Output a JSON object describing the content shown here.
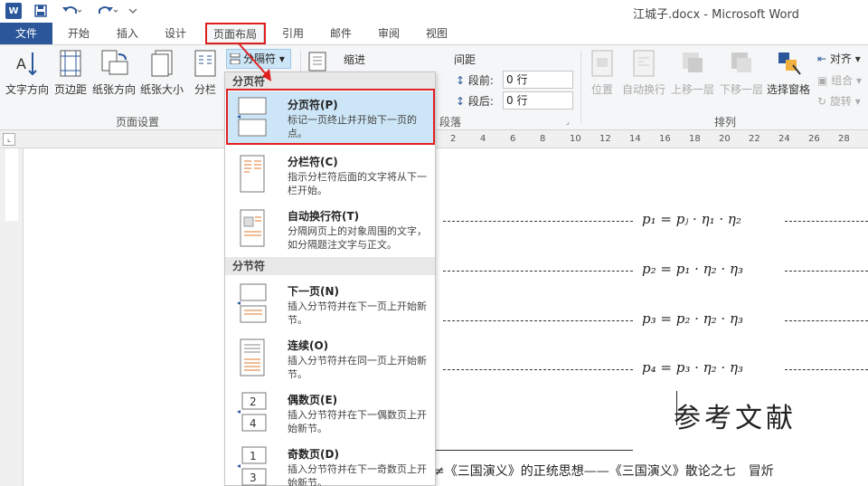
{
  "title": "江城子.docx - Microsoft Word",
  "quick_access": {
    "word": "W",
    "save": "save-icon",
    "undo": "undo-icon",
    "redo": "redo-icon"
  },
  "tabs": [
    "文件",
    "开始",
    "插入",
    "设计",
    "页面布局",
    "引用",
    "邮件",
    "审阅",
    "视图"
  ],
  "ribbon": {
    "page_setup": {
      "buttons": [
        "文字方向",
        "页边距",
        "纸张方向",
        "纸张大小",
        "分栏"
      ],
      "label": "页面设置"
    },
    "breaks_label": "分隔符",
    "indent_label": "缩进",
    "spacing_label": "间距",
    "before_label": "段前:",
    "before_value": "0 行",
    "after_label": "段后:",
    "after_value": "0 行",
    "paragraph_label": "段落",
    "arrange": {
      "buttons": [
        "位置",
        "自动换行",
        "上移一层",
        "下移一层",
        "选择窗格"
      ],
      "side": [
        "对齐",
        "组合",
        "旋转"
      ],
      "label": "排列"
    }
  },
  "ruler_numbers": [
    "2",
    "4",
    "6",
    "8",
    "10",
    "12",
    "14",
    "16",
    "18",
    "20",
    "22",
    "24",
    "26",
    "28"
  ],
  "menu": {
    "section1": "分页符",
    "section2": "分节符",
    "items": [
      {
        "title": "分页符(P)",
        "desc": "标记一页终止并开始下一页的点。"
      },
      {
        "title": "分栏符(C)",
        "desc": "指示分栏符后面的文字将从下一栏开始。"
      },
      {
        "title": "自动换行符(T)",
        "desc": "分隔网页上的对象周围的文字，如分隔题注文字与正文。"
      },
      {
        "title": "下一页(N)",
        "desc": "插入分节符并在下一页上开始新节。"
      },
      {
        "title": "连续(O)",
        "desc": "插入分节符并在同一页上开始新节。"
      },
      {
        "title": "偶数页(E)",
        "desc": "插入分节符并在下一偶数页上开始新节。"
      },
      {
        "title": "奇数页(D)",
        "desc": "插入分节符并在下一奇数页上开始新节。"
      }
    ]
  },
  "document": {
    "formulas": [
      "p₁ = pⱼ · η₁ · η₂",
      "p₂ = p₁ · η₂ · η₃",
      "p₃ = p₂ · η₂ · η₃",
      "p₄ = p₃ · η₂ · η₃"
    ],
    "heading": "参考文献",
    "ref_line": "≠《三国演义》的正统思想——《三国演义》散论之七　冒炘"
  },
  "colors": {
    "accent": "#2b579a",
    "highlight_red": "#e02020",
    "menu_hover": "#cde6f7"
  }
}
